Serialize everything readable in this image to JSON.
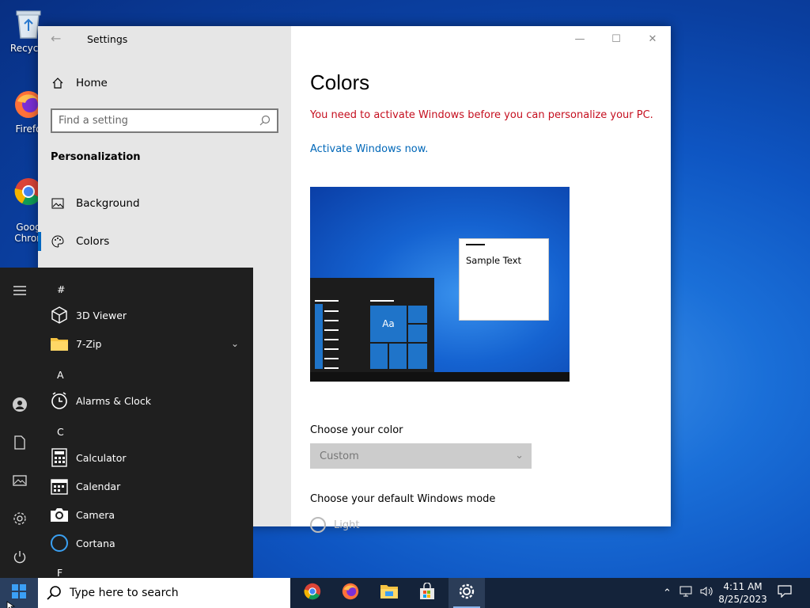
{
  "desktop": {
    "icons": [
      {
        "label": "Recycle"
      },
      {
        "label": "Firefo"
      },
      {
        "label": "Goog\nChron"
      }
    ]
  },
  "settings": {
    "title": "Settings",
    "nav": {
      "home": "Home",
      "search_placeholder": "Find a setting",
      "section": "Personalization",
      "items": [
        {
          "label": "Background",
          "icon": "picture-icon"
        },
        {
          "label": "Colors",
          "icon": "palette-icon",
          "selected": true
        }
      ]
    },
    "content": {
      "title": "Colors",
      "warning": "You need to activate Windows before you can personalize your PC.",
      "activate_link": "Activate Windows now.",
      "preview": {
        "sample_text": "Sample Text",
        "tile_text": "Aa"
      },
      "choose_color_label": "Choose your color",
      "color_value": "Custom",
      "mode_label": "Choose your default Windows mode",
      "mode_option": "Light"
    },
    "colors": {
      "warning": "#c50f1f",
      "link": "#0067b8",
      "accent": "#0067c0"
    }
  },
  "start_menu": {
    "groups": [
      {
        "letter": "#",
        "apps": [
          {
            "name": "3D Viewer",
            "icon": "cube-icon"
          },
          {
            "name": "7-Zip",
            "icon": "folder-icon",
            "expandable": true
          }
        ]
      },
      {
        "letter": "A",
        "apps": [
          {
            "name": "Alarms & Clock",
            "icon": "clock-icon"
          }
        ]
      },
      {
        "letter": "C",
        "apps": [
          {
            "name": "Calculator",
            "icon": "calculator-icon"
          },
          {
            "name": "Calendar",
            "icon": "calendar-icon"
          },
          {
            "name": "Camera",
            "icon": "camera-icon"
          },
          {
            "name": "Cortana",
            "icon": "cortana-icon"
          }
        ]
      },
      {
        "letter": "F",
        "apps": []
      }
    ]
  },
  "taskbar": {
    "search_placeholder": "Type here to search",
    "pinned": [
      "chrome-icon",
      "firefox-icon",
      "file-explorer-icon",
      "store-icon",
      "settings-icon"
    ],
    "time": "4:11 AM",
    "date": "8/25/2023"
  }
}
